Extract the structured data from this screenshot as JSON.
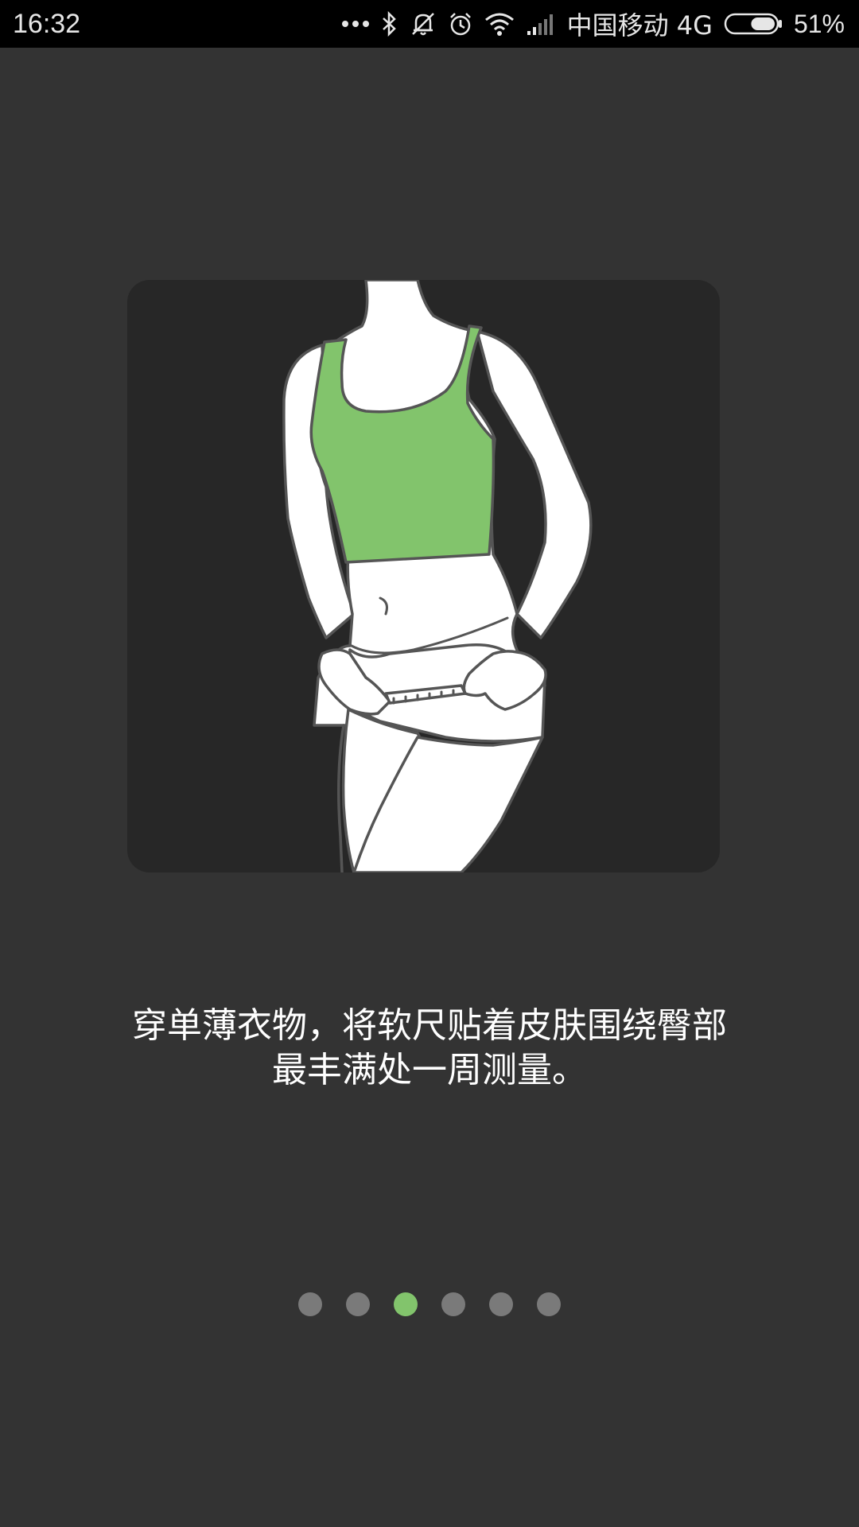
{
  "status_bar": {
    "time": "16:32",
    "icons": [
      "more-icon",
      "bluetooth-icon",
      "mute-icon",
      "alarm-icon",
      "wifi-icon",
      "signal-icon"
    ],
    "carrier": "中国移动 4G",
    "battery_percent": "51%",
    "battery_level": 0.51
  },
  "illustration": {
    "icon": "hip-measurement-illustration",
    "accent_color": "#82c46c"
  },
  "instruction": {
    "line1": "穿单薄衣物，将软尺贴着皮肤围绕臀部",
    "line2": "最丰满处一周测量。"
  },
  "pager": {
    "total": 6,
    "active_index": 2,
    "active_color": "#82c46c",
    "inactive_color": "#7a7a7a"
  }
}
